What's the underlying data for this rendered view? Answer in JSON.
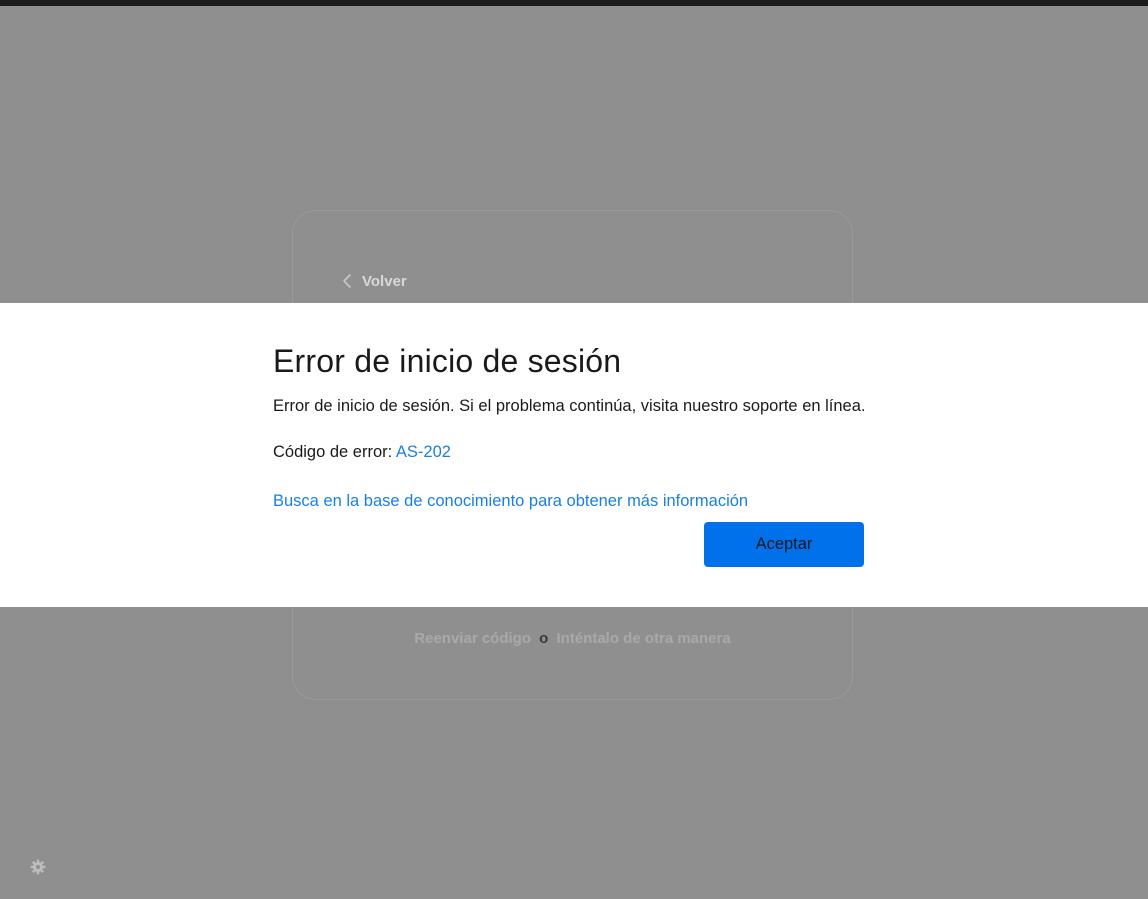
{
  "background": {
    "back_label": "Volver",
    "footer": {
      "resend_label": "Reenviar código",
      "separator": "o",
      "other_way_label": "Inténtalo de otra manera"
    }
  },
  "modal": {
    "title": "Error de inicio de sesión",
    "message": "Error de inicio de sesión. Si el problema continúa, visita nuestro soporte en línea.",
    "error_code_label": "Código de error:",
    "error_code": "AS-202",
    "kb_link": "Busca en la base de conocimiento para obtener más información",
    "accept_label": "Aceptar"
  },
  "icons": {
    "back": "chevron-left-icon",
    "settings": "gear-icon"
  },
  "colors": {
    "overlay": "#8f8f8f",
    "link": "#1a7fe0",
    "primary_button": "#0071ea"
  }
}
